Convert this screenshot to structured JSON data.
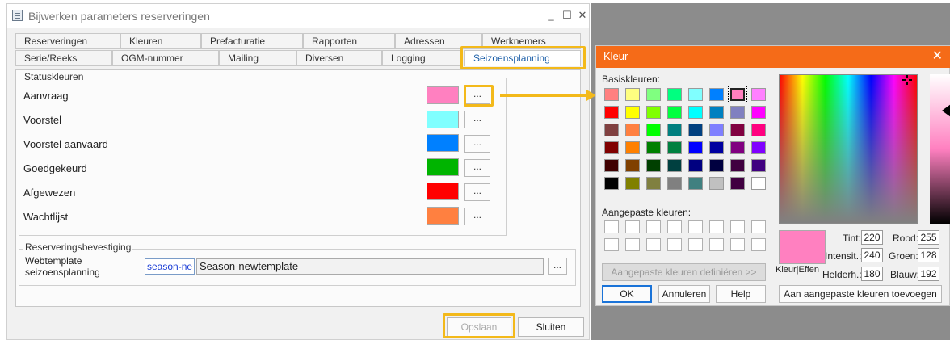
{
  "window": {
    "title": "Bijwerken parameters reserveringen",
    "controls": [
      "_",
      "☐",
      "✕"
    ]
  },
  "tabs_row1": [
    "Reserveringen",
    "Kleuren",
    "Prefacturatie",
    "Rapporten",
    "Adressen",
    "Werknemers"
  ],
  "tabs_row2": [
    "Serie/Reeks",
    "OGM-nummer",
    "Mailing",
    "Diversen",
    "Logging",
    "Seizoensplanning"
  ],
  "status_group": {
    "legend": "Statuskleuren",
    "items": [
      {
        "label": "Aanvraag",
        "color": "#ff80c0"
      },
      {
        "label": "Voorstel",
        "color": "#80ffff"
      },
      {
        "label": "Voorstel aanvaard",
        "color": "#0080ff"
      },
      {
        "label": "Goedgekeurd",
        "color": "#00b400"
      },
      {
        "label": "Afgewezen",
        "color": "#ff0000"
      },
      {
        "label": "Wachtlijst",
        "color": "#ff8040"
      }
    ],
    "button_label": "..."
  },
  "confirm_group": {
    "legend": "Reserveringsbevestiging",
    "field_label_line1": "Webtemplate",
    "field_label_line2": "seizoensplanning",
    "code_value": "season-ne",
    "name_value": "Season-newtemplate",
    "button_label": "..."
  },
  "footer": {
    "save_label": "Opslaan",
    "close_label": "Sluiten"
  },
  "color_dialog": {
    "title": "Kleur",
    "basic_label": "Basiskleuren:",
    "custom_label": "Aangepaste kleuren:",
    "define_label": "Aangepaste kleuren definiëren >>",
    "ok_label": "OK",
    "cancel_label": "Annuleren",
    "help_label": "Help",
    "add_label": "Aan aangepaste kleuren toevoegen",
    "solid_label": "Kleur|Effen",
    "preview_color": "#ff80c0",
    "selected_index": 6,
    "basic_colors": [
      "#ff8080",
      "#ffff80",
      "#80ff80",
      "#00ff80",
      "#80ffff",
      "#0080ff",
      "#ff80c0",
      "#ff80ff",
      "#ff0000",
      "#ffff00",
      "#80ff00",
      "#00ff40",
      "#00ffff",
      "#0080c0",
      "#8080c0",
      "#ff00ff",
      "#804040",
      "#ff8040",
      "#00ff00",
      "#008080",
      "#004080",
      "#8080ff",
      "#800040",
      "#ff0080",
      "#800000",
      "#ff8000",
      "#008000",
      "#008040",
      "#0000ff",
      "#0000a0",
      "#800080",
      "#8000ff",
      "#400000",
      "#804000",
      "#004000",
      "#004040",
      "#000080",
      "#000040",
      "#400040",
      "#400080",
      "#000000",
      "#808000",
      "#808040",
      "#808080",
      "#408080",
      "#c0c0c0",
      "#400040",
      "#ffffff"
    ],
    "fields": {
      "tint_label": "Tint:",
      "tint": "220",
      "sat_label": "Intensit.:",
      "sat": "240",
      "lum_label": "Helderh.:",
      "lum": "180",
      "red_label": "Rood:",
      "red": "255",
      "green_label": "Groen:",
      "green": "128",
      "blue_label": "Blauw:",
      "blue": "192"
    }
  },
  "highlight_color": "#f3b91a"
}
